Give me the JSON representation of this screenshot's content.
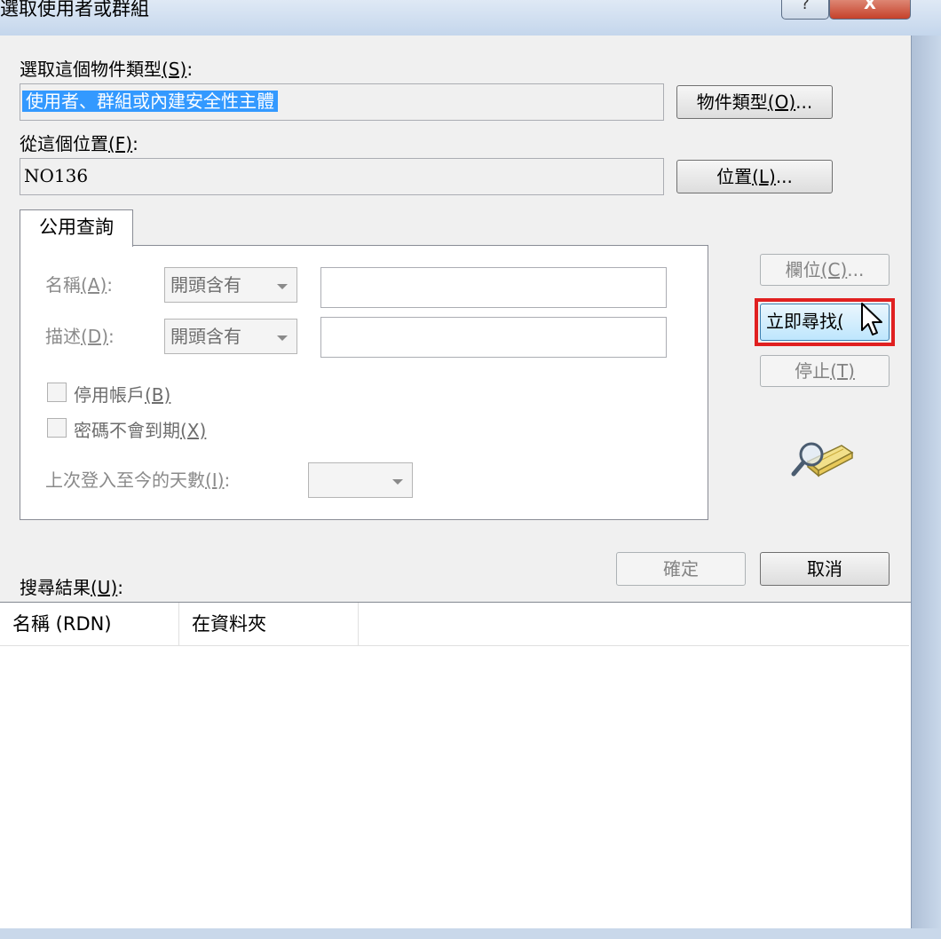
{
  "window": {
    "title": "選取使用者或群組",
    "help_glyph": "?",
    "close_glyph": "X"
  },
  "object_type": {
    "label": "選取這個物件類型",
    "mnemonic": "(S)",
    "suffix": ":",
    "value": "使用者、群組或內建安全性主體",
    "button_label": "物件類型",
    "button_mnemonic": "(O)",
    "button_suffix": "..."
  },
  "location": {
    "label": "從這個位置",
    "mnemonic": "(F)",
    "suffix": ":",
    "value": "NO136",
    "button_label": "位置",
    "button_mnemonic": "(L)",
    "button_suffix": "..."
  },
  "tab": {
    "label": "公用查詢"
  },
  "query": {
    "name_label": "名稱",
    "name_mnemonic": "(A)",
    "name_suffix": ":",
    "name_mode": "開頭含有",
    "desc_label": "描述",
    "desc_mnemonic": "(D)",
    "desc_suffix": ":",
    "desc_mode": "開頭含有",
    "disabled_accounts_label": "停用帳戶",
    "disabled_accounts_mnemonic": "(B)",
    "nonexpiring_label": "密碼不會到期",
    "nonexpiring_mnemonic": "(X)",
    "days_label": "上次登入至今的天數",
    "days_mnemonic": "(I)",
    "days_suffix": ":"
  },
  "side_buttons": {
    "columns_label": "欄位",
    "columns_mnemonic": "(C)",
    "columns_suffix": "...",
    "find_now_label": "立即尋找",
    "find_now_mnemonic": "(",
    "stop_label": "停止",
    "stop_mnemonic": "(T)"
  },
  "footer": {
    "ok_label": "確定",
    "cancel_label": "取消"
  },
  "results": {
    "label": "搜尋結果",
    "mnemonic": "(U)",
    "suffix": ":",
    "columns": [
      "名稱 (RDN)",
      "在資料夾"
    ]
  },
  "icons": {
    "search_icon": "magnifier-over-book-icon",
    "cursor_icon": "mouse-pointer-icon"
  },
  "colors": {
    "selection": "#3399ff",
    "highlight_box": "#e02020",
    "title_bar": "#c9d8ea"
  }
}
